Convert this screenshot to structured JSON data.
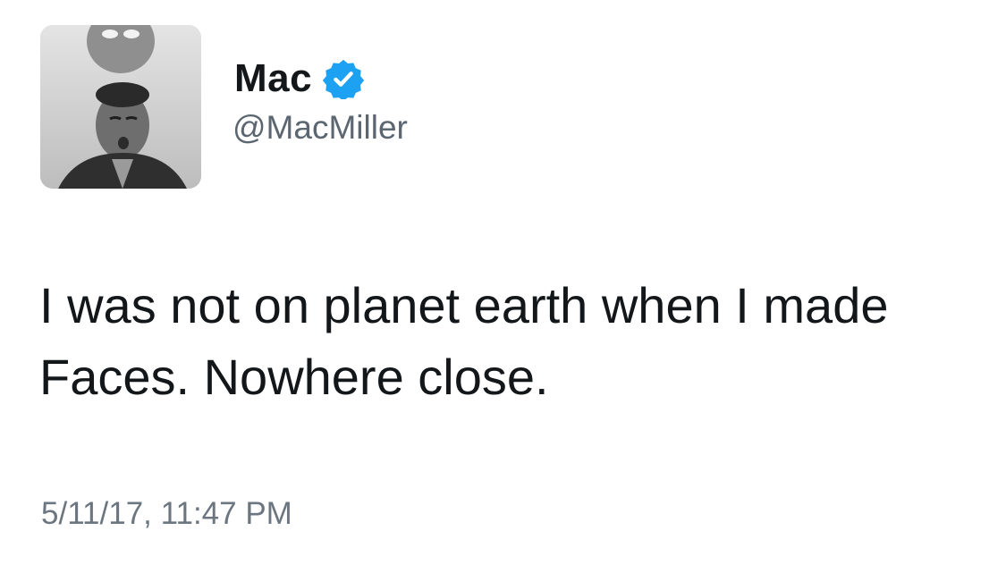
{
  "author": {
    "display_name": "Mac",
    "handle": "@MacMiller",
    "verified": true,
    "verified_color": "#1da1f2",
    "avatar_icon": "profile-photo-grayscale"
  },
  "tweet": {
    "text": "I was not on planet earth when I made Faces. Nowhere close.",
    "timestamp": "5/11/17, 11:47 PM"
  }
}
